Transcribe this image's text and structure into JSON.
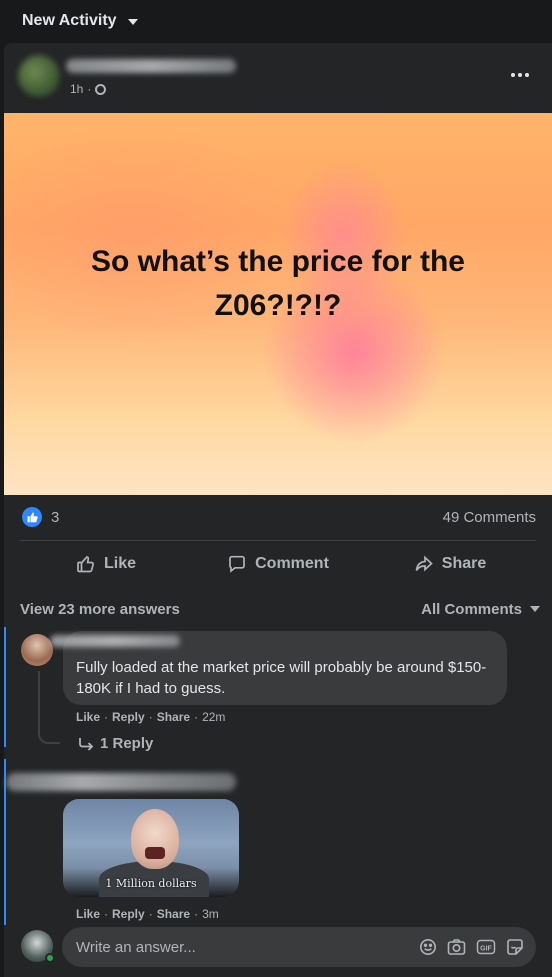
{
  "topbar": {
    "title": "New Activity"
  },
  "post": {
    "time": "1h",
    "text": "So what’s the price for the Z06?!?!?",
    "reactions_count": "3",
    "comments_count": "49 Comments"
  },
  "actions": {
    "like": "Like",
    "comment": "Comment",
    "share": "Share"
  },
  "filters": {
    "view_more": "View 23 more answers",
    "sort": "All Comments"
  },
  "comment1": {
    "text": "Fully loaded at the market price will probably be around $150-180K if I had to guess.",
    "like": "Like",
    "reply": "Reply",
    "share": "Share",
    "time": "22m",
    "replies": "1 Reply"
  },
  "comment2": {
    "gif_caption": "1 Million dollars",
    "like": "Like",
    "reply": "Reply",
    "share": "Share",
    "time": "3m"
  },
  "composer": {
    "placeholder": "Write an answer..."
  },
  "colors": {
    "accent": "#2d88ff",
    "online": "#31a24c",
    "background": "#242526"
  }
}
